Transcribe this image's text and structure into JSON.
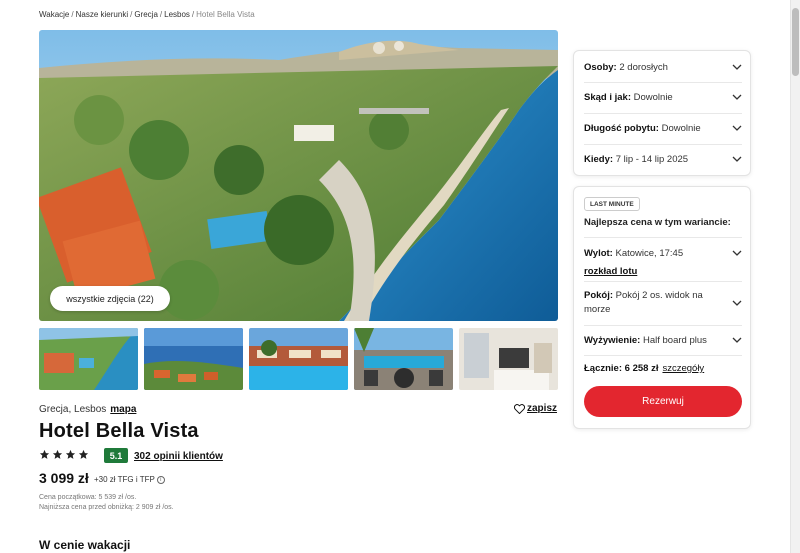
{
  "breadcrumb": [
    "Wakacje",
    "Nasze kierunki",
    "Grecja",
    "Lesbos",
    "Hotel Bella Vista"
  ],
  "gallery": {
    "all_photos_label": "wszystkie zdjęcia (22)",
    "thumbnails": [
      "beach-aerial",
      "coast-town",
      "pool-resort",
      "terrace-pool",
      "hotel-room"
    ]
  },
  "hotel": {
    "location": "Grecja, Lesbos",
    "map_link": "mapa",
    "save_label": "zapisz",
    "name": "Hotel Bella Vista",
    "stars": 4,
    "rating": "5.1",
    "reviews": "302 opinii klientów"
  },
  "price": {
    "main": "3 099 zł",
    "extra": "+30 zł TFG i TFP",
    "initial_note": "Cena początkowa: 5 539 zł /os.",
    "lowest_note": "Najniższa cena przed obniżką: 2 909 zł /os."
  },
  "section": {
    "title": "W cenie wakacji"
  },
  "search_panel": {
    "rows": [
      {
        "label": "Osoby:",
        "value": "2 dorosłych"
      },
      {
        "label": "Skąd i jak:",
        "value": "Dowolnie"
      },
      {
        "label": "Długość pobytu:",
        "value": "Dowolnie"
      },
      {
        "label": "Kiedy:",
        "value": "7 lip - 14 lip 2025"
      }
    ]
  },
  "offer_panel": {
    "badge": "LAST MINUTE",
    "best_price": "Najlepsza cena w tym wariancie:",
    "flight_label": "Wylot:",
    "flight_value": "Katowice, 17:45",
    "flight_link": "rozkład lotu",
    "room_label": "Pokój:",
    "room_value": "Pokój 2 os. widok na morze",
    "board_label": "Wyżywienie:",
    "board_value": "Half board plus",
    "total_label": "Łącznie:",
    "total_value": "6 258 zł",
    "details_link": "szczegóły",
    "reserve_label": "Rezerwuj"
  },
  "colors": {
    "accent": "#e3262f",
    "rating": "#1f7a3a"
  },
  "icons": [
    "heart-icon",
    "star-icon",
    "chevron-down-icon",
    "info-icon"
  ]
}
